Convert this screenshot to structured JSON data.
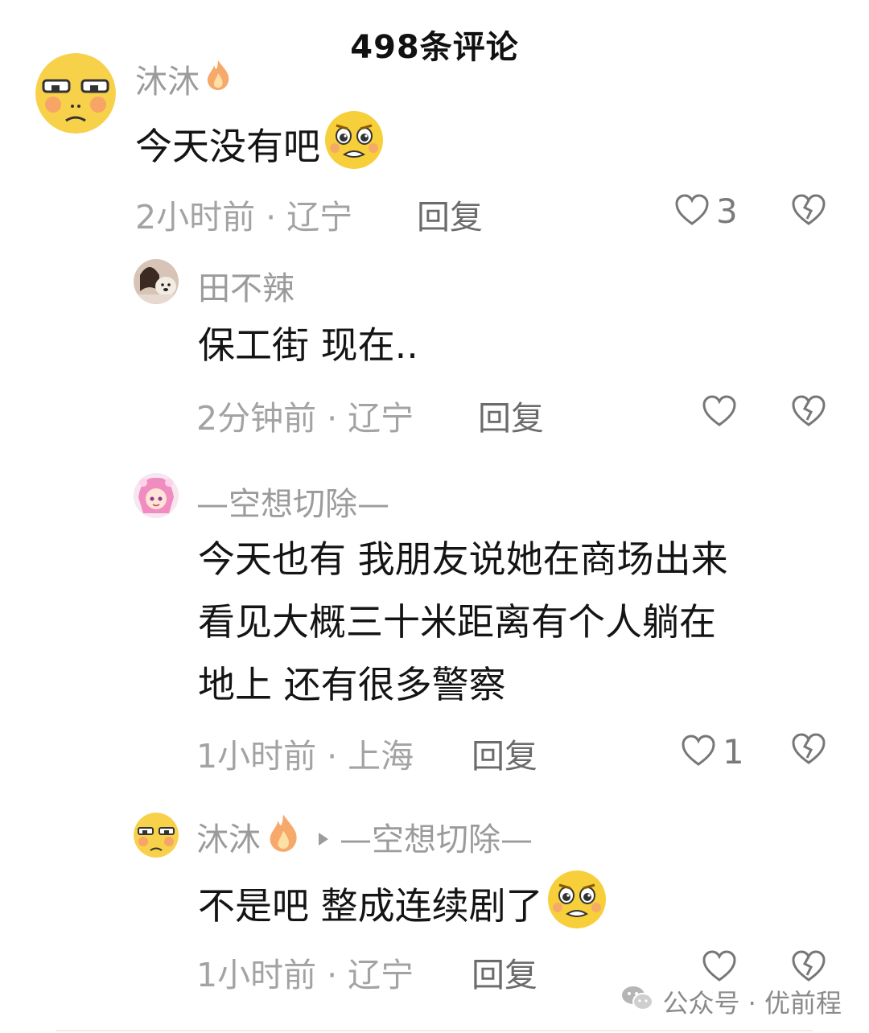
{
  "header": {
    "title": "498条评论"
  },
  "comments": [
    {
      "username": "沐沐",
      "text": "今天没有吧",
      "time_location": "2小时前 · 辽宁",
      "reply_label": "回复",
      "likes": "3"
    },
    {
      "username": "田不辣",
      "text": "保工街 现在..",
      "time_location": "2分钟前 · 辽宁",
      "reply_label": "回复",
      "likes": ""
    },
    {
      "username": "—空想切除—",
      "text_lines": [
        "今天也有 我朋友说她在商场出来",
        "看见大概三十米距离有个人躺在",
        "地上 还有很多警察"
      ],
      "time_location": "1小时前 · 上海",
      "reply_label": "回复",
      "likes": "1"
    },
    {
      "username": "沐沐",
      "reply_to": "—空想切除—",
      "text": "不是吧 整成连续剧了",
      "time_location": "1小时前 · 辽宁",
      "reply_label": "回复",
      "likes": ""
    }
  ],
  "watermark": {
    "text": "公众号 · 优前程",
    "icon": "wechat-icon"
  },
  "icons": {
    "like": "heart-outline-icon",
    "dislike": "broken-heart-icon",
    "emoji": "pleading-face-emoji",
    "fire": "fire-icon",
    "arrow": "reply-arrow-icon"
  },
  "colors": {
    "secondary_text": "#9b9b9b",
    "primary_text": "#141414",
    "emoji_yellow": "#f7cf3a"
  }
}
